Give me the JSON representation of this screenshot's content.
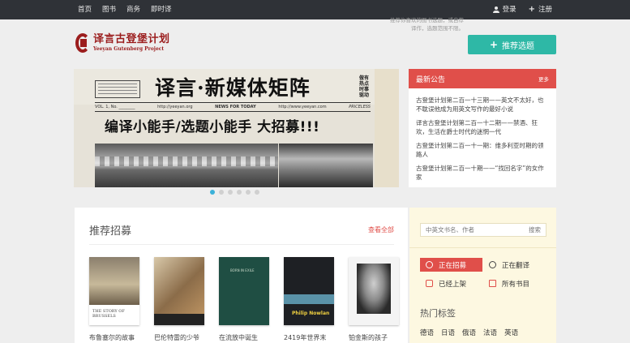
{
  "topnav": {
    "items": [
      "首页",
      "图书",
      "商务",
      "即时译"
    ],
    "login": "登录",
    "register": "注册"
  },
  "header": {
    "logo_cn": "译言古登堡计划",
    "logo_en": "Yeeyan Gutenberg Project",
    "hint": "推荐你喜欢的图书选题，或自荐译作，选题范围不限。",
    "recommend_button": "推荐选题"
  },
  "banner": {
    "headline": "译言·新媒体矩阵",
    "vertical_text": "做有热点时事驱动",
    "strip_left": "VOL. 1, No. ________",
    "strip_mid1": "http://yeeyan.org",
    "strip_mid2": "NEWS FOR TODAY",
    "strip_mid3": "http://www.yeeyan.com",
    "strip_right": "PRICELESS",
    "subhead": "编译小能手/选题小能手 大招募!!!",
    "dots": 6,
    "active_dot": 0
  },
  "notice": {
    "title": "最新公告",
    "more": "更多",
    "items": [
      "古登堡计划第二百一十三期——英文不太好，也不耽误他成为用英文写作的最好小说",
      "译言古登堡计划第二百一十二期——禁酒、狂欢，生活在爵士时代的迷惘一代",
      "古登堡计划第二百一十一期：维多利亚时期的领路人",
      "古登堡计划第二百一十期——“找回名字”的女作家"
    ]
  },
  "recommend": {
    "title": "推荐招募",
    "view_all": "查看全部",
    "books": [
      {
        "name": "布鲁塞尔的故事",
        "cover_text": "THE STORY OF BRUSSELS"
      },
      {
        "name": "巴伦特雷的少爷",
        "cover_text": ""
      },
      {
        "name": "在流放中诞生",
        "cover_text": "BORN IN EXILE"
      },
      {
        "name": "2419年世界末",
        "cover_text": "Philip Nowlan"
      },
      {
        "name": "铂金斯的孩子",
        "cover_text": ""
      }
    ]
  },
  "sidebar": {
    "search_placeholder": "中英文书名、作者",
    "search_button": "搜索",
    "filters": [
      "正在招募",
      "正在翻译",
      "已经上架",
      "所有书目"
    ],
    "tags_title": "热门标签",
    "tags": [
      "德语",
      "日语",
      "俄语",
      "法语",
      "英语"
    ]
  },
  "colors": {
    "topbar": "#2f3237",
    "accent_red": "#e04f4a",
    "accent_teal": "#2eb8a6",
    "brand": "#9b1d1d",
    "dot_active": "#3bb1d9"
  }
}
